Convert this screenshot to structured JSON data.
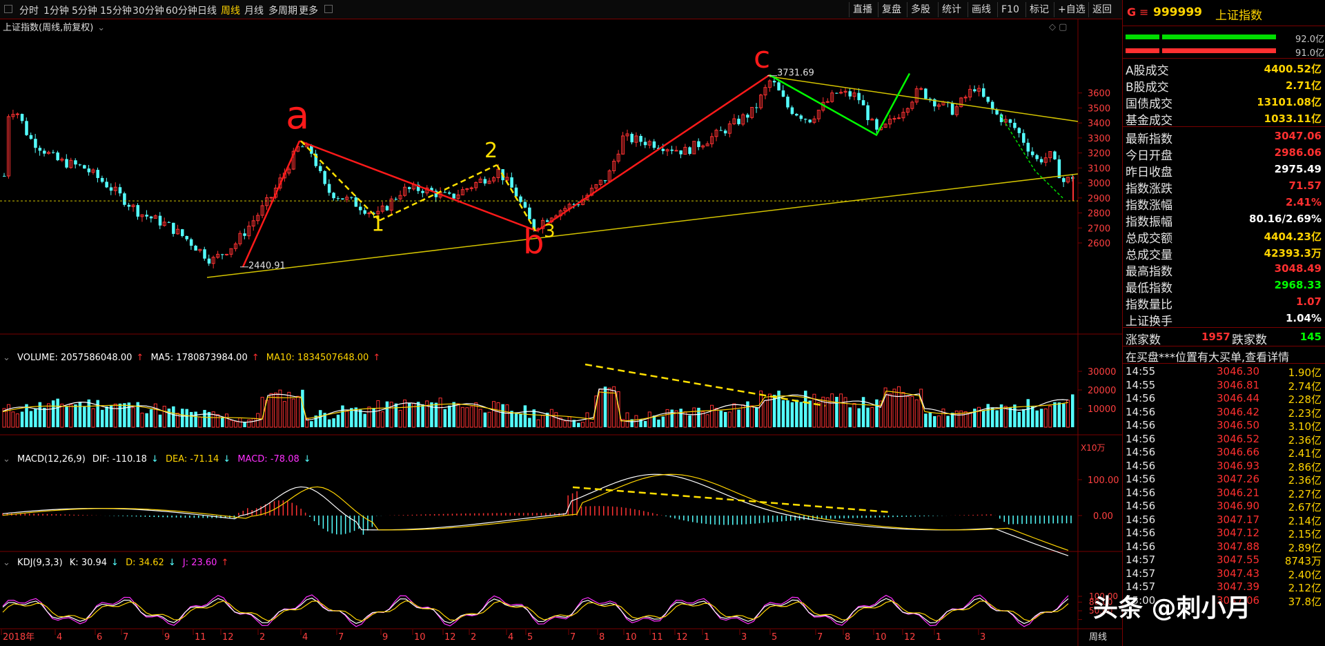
{
  "toolbar": {
    "left_items": [
      "分时",
      "1分钟",
      "5分钟",
      "15分钟",
      "30分钟",
      "60分钟",
      "日线",
      "周线",
      "月线",
      "多周期",
      "更多"
    ],
    "active": "周线",
    "right_items": [
      "直播",
      "复盘",
      "多股",
      "统计",
      "画线",
      "F10",
      "标记",
      "+自选",
      "返回"
    ]
  },
  "chart_title": "上证指数(周线,前复权)",
  "main": {
    "y_ticks": [
      3600,
      3500,
      3400,
      3300,
      3200,
      3100,
      3000,
      2900,
      2800,
      2700,
      2600
    ],
    "high_label": "3731.69",
    "low_label": "2440.91",
    "wave_labels": {
      "a": "a",
      "b": "b",
      "c": "c",
      "n1": "1",
      "n2": "2",
      "n3": "3"
    },
    "colors": {
      "up": "#ff3232",
      "down": "#54ffff",
      "wave_red": "#ff1a1a",
      "wave_yellow": "#ffe000",
      "wave_green": "#00ff00",
      "trend": "#d4c400"
    }
  },
  "volume": {
    "label": "VOLUME: 2057586048.00",
    "ma5": "MA5: 1780873984.00",
    "ma10": "MA10: 1834507648.00",
    "y_ticks": [
      30000,
      20000,
      10000
    ],
    "unit": "X10万"
  },
  "macd": {
    "label": "MACD(12,26,9)",
    "dif": "DIF: -110.18",
    "dea": "DEA: -71.14",
    "macd": "MACD: -78.08",
    "y_ticks": [
      "100.00",
      "0.00"
    ]
  },
  "kdj": {
    "label": "KDJ(9,3,3)",
    "k": "K: 30.94",
    "d": "D: 34.62",
    "j": "J: 23.60",
    "y_ticks": [
      "100.00",
      "80.00",
      "50.00",
      "20.00"
    ]
  },
  "x_axis": {
    "labels": [
      "2018年",
      "4",
      "6",
      "7",
      "9",
      "11",
      "12",
      "2",
      "4",
      "7",
      "9",
      "10",
      "12",
      "2",
      "4",
      "5",
      "7",
      "8",
      "10",
      "11",
      "12",
      "1",
      "3",
      "5",
      "7",
      "8",
      "10",
      "12",
      "1",
      "3"
    ],
    "period": "周线"
  },
  "info": {
    "g": "G",
    "eq": "≡",
    "code": "999999",
    "name": "上证指数",
    "bars": [
      {
        "value": "92.0亿",
        "color": "#00dd00",
        "split": 0.23
      },
      {
        "value": "91.0亿",
        "color": "#ff3030",
        "split": 0.23
      }
    ],
    "rows_a": [
      {
        "label": "A股成交",
        "value": "4400.52亿",
        "color": "#ffd400"
      },
      {
        "label": "B股成交",
        "value": "2.71亿",
        "color": "#ffd400"
      },
      {
        "label": "国债成交",
        "value": "13101.08亿",
        "color": "#ffd400"
      },
      {
        "label": "基金成交",
        "value": "1033.11亿",
        "color": "#ffd400"
      }
    ],
    "rows_b": [
      {
        "label": "最新指数",
        "value": "3047.06",
        "color": "#ff3030"
      },
      {
        "label": "今日开盘",
        "value": "2986.06",
        "color": "#ff3030"
      },
      {
        "label": "昨日收盘",
        "value": "2975.49",
        "color": "#ffffff"
      },
      {
        "label": "指数涨跌",
        "value": "71.57",
        "color": "#ff3030"
      },
      {
        "label": "指数涨幅",
        "value": "2.41%",
        "color": "#ff3030"
      },
      {
        "label": "指数振幅",
        "value": "80.16/2.69%",
        "color": "#ffffff"
      },
      {
        "label": "总成交额",
        "value": "4404.23亿",
        "color": "#ffd400"
      },
      {
        "label": "总成交量",
        "value": "42393.3万",
        "color": "#ffd400"
      },
      {
        "label": "最高指数",
        "value": "3048.49",
        "color": "#ff3030"
      },
      {
        "label": "最低指数",
        "value": "2968.33",
        "color": "#00ff00"
      },
      {
        "label": "指数量比",
        "value": "1.07",
        "color": "#ff3030"
      },
      {
        "label": "上证换手",
        "value": "1.04%",
        "color": "#ffffff"
      }
    ],
    "rise_label": "涨家数",
    "rise_value": "1957",
    "fall_label": "跌家数",
    "fall_value": "145",
    "notice": "在买盘***位置有大买单,查看详情",
    "ticks": [
      {
        "time": "14:55",
        "price": "3046.30",
        "vol": "1.90亿"
      },
      {
        "time": "14:55",
        "price": "3046.81",
        "vol": "2.74亿"
      },
      {
        "time": "14:56",
        "price": "3046.44",
        "vol": "2.28亿"
      },
      {
        "time": "14:56",
        "price": "3046.42",
        "vol": "2.23亿"
      },
      {
        "time": "14:56",
        "price": "3046.50",
        "vol": "3.10亿"
      },
      {
        "time": "14:56",
        "price": "3046.52",
        "vol": "2.36亿"
      },
      {
        "time": "14:56",
        "price": "3046.66",
        "vol": "2.41亿"
      },
      {
        "time": "14:56",
        "price": "3046.93",
        "vol": "2.86亿"
      },
      {
        "time": "14:56",
        "price": "3047.26",
        "vol": "2.36亿"
      },
      {
        "time": "14:56",
        "price": "3046.21",
        "vol": "2.27亿"
      },
      {
        "time": "14:56",
        "price": "3046.90",
        "vol": "2.67亿"
      },
      {
        "time": "14:56",
        "price": "3047.17",
        "vol": "2.14亿"
      },
      {
        "time": "14:56",
        "price": "3047.12",
        "vol": "2.15亿"
      },
      {
        "time": "14:56",
        "price": "3047.88",
        "vol": "2.89亿"
      },
      {
        "time": "14:57",
        "price": "3047.55",
        "vol": "8743万"
      },
      {
        "time": "14:57",
        "price": "3047.43",
        "vol": "2.40亿"
      },
      {
        "time": "14:57",
        "price": "3047.39",
        "vol": "2.12亿"
      },
      {
        "time": "15:00",
        "price": "3047.06",
        "vol": "37.8亿"
      }
    ]
  },
  "watermark": "头条 @刺小月"
}
